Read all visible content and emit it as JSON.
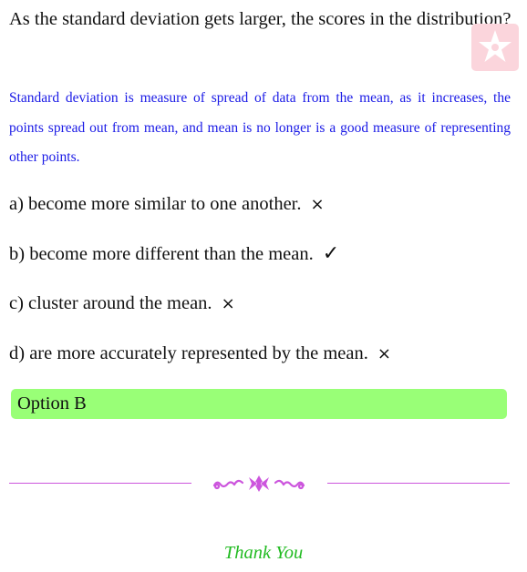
{
  "question": "As the standard deviation gets larger, the scores in the distribution?",
  "explanation": "Standard deviation is measure of spread of data from the mean, as it increases, the points spread out from mean, and mean is no longer is a good measure of representing other points.",
  "options": [
    {
      "text": "a) become more similar to one another.",
      "mark": "×",
      "correct": false
    },
    {
      "text": "b) become more different than the mean.",
      "mark": "✓",
      "correct": true
    },
    {
      "text": "c) cluster around the mean.",
      "mark": "×",
      "correct": false
    },
    {
      "text": "d) are more accurately represented by the mean.",
      "mark": "×",
      "correct": false
    }
  ],
  "answer": "Option B",
  "closing": "Thank You",
  "colors": {
    "explanation": "#1a1ae6",
    "answer_background": "#99ff77",
    "divider": "#cc55dd",
    "closing": "#22bb22",
    "watermark": "#fbd5dc"
  },
  "icons": {
    "watermark": "star-logo-icon",
    "ornament": "flourish-ornament-icon"
  }
}
